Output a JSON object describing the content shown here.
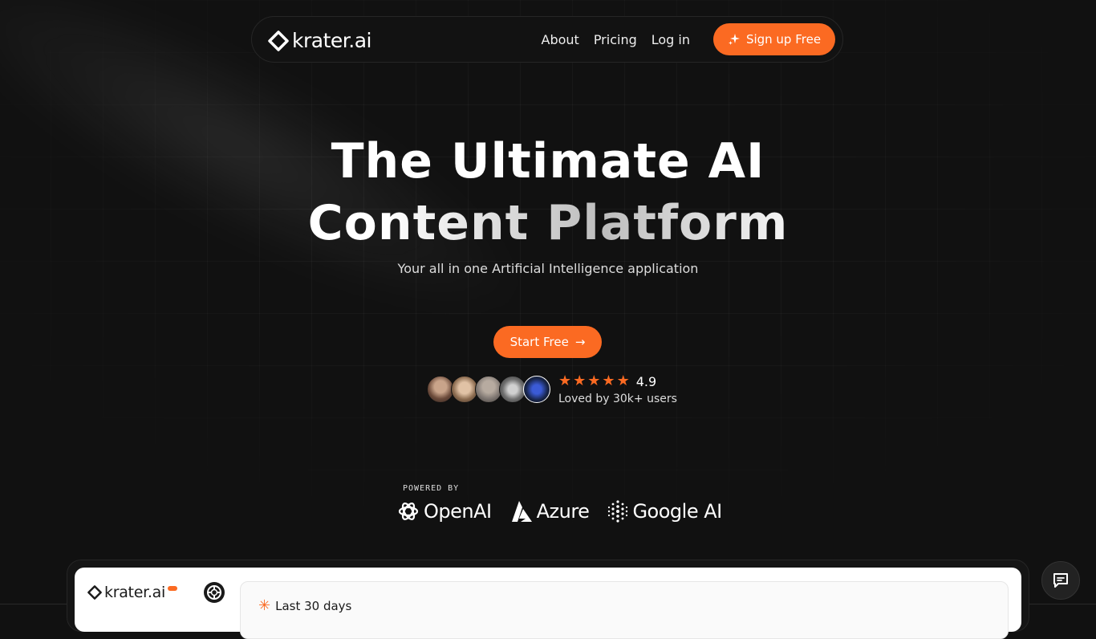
{
  "nav": {
    "logo_text": "krater.ai",
    "links": [
      "About",
      "Pricing",
      "Log in"
    ],
    "signup_label": "Sign up Free"
  },
  "hero": {
    "title_line1": "The Ultimate AI",
    "title_line2": "Content Platform",
    "subtitle": "Your all in one Artificial Intelligence application",
    "cta_label": "Start Free",
    "cta_arrow": "→"
  },
  "social_proof": {
    "rating": "4.9",
    "stars": 5,
    "loved_text": "Loved by 30k+ users",
    "avatar_count": 5
  },
  "powered_by": {
    "label": "POWERED BY",
    "brands": [
      "OpenAI",
      "Azure",
      "Google AI"
    ]
  },
  "preview": {
    "logo_text": "krater.ai",
    "period_label": "Last 30 days"
  },
  "colors": {
    "accent": "#fb6a22",
    "background": "#111111"
  },
  "icons": {
    "logo": "diamond-logo-icon",
    "signup": "sparkle-icon",
    "cta": "arrow-right-icon",
    "star": "star-icon",
    "chat": "chat-bubble-icon"
  }
}
